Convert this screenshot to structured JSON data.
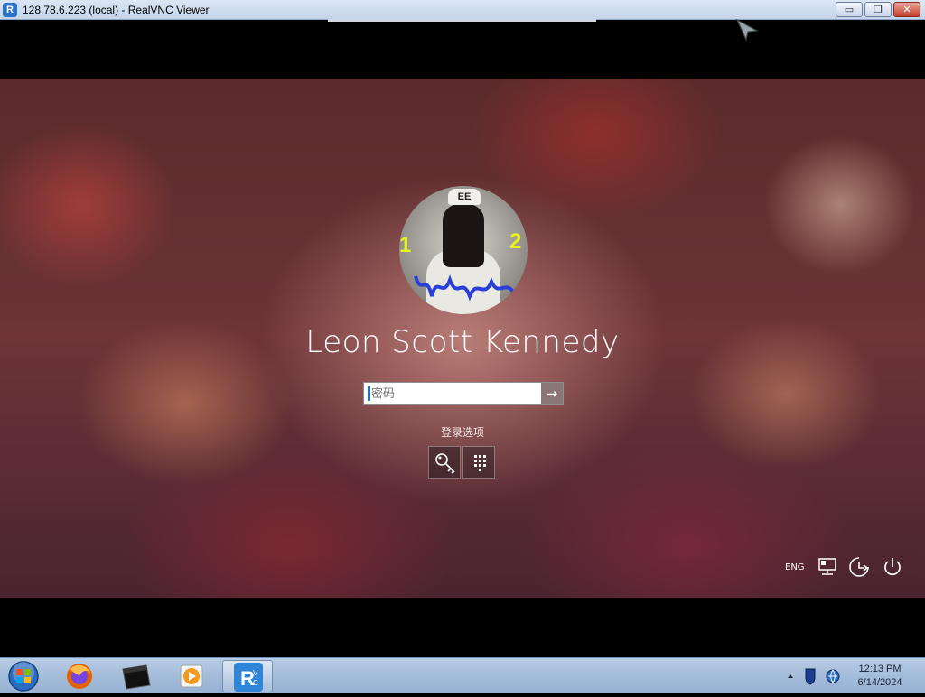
{
  "window": {
    "title": "128.78.6.223 (local) - RealVNC Viewer",
    "app_icon_letter": "R",
    "minimize_glyph": "▭",
    "maximize_glyph": "❐",
    "close_glyph": "✕"
  },
  "lockscreen": {
    "avatar": {
      "cap_text": "EE",
      "number_left": "1",
      "number_right": "2"
    },
    "username": "Leon Scott Kennedy",
    "password_placeholder": "密码",
    "submit_glyph": "→",
    "signin_options_label": "登录选项",
    "signin_options": [
      {
        "name": "password-key",
        "icon": "key-icon"
      },
      {
        "name": "pin-keypad",
        "icon": "keypad-icon"
      }
    ],
    "language": "ENG",
    "system_icons": [
      "network-icon",
      "accessibility-icon",
      "power-icon"
    ]
  },
  "taskbar": {
    "items": [
      {
        "name": "start-orb",
        "icon": "windows-orb-icon"
      },
      {
        "name": "firefox",
        "icon": "firefox-icon"
      },
      {
        "name": "terminal",
        "icon": "terminal-icon"
      },
      {
        "name": "media-player",
        "icon": "media-player-icon"
      },
      {
        "name": "realvnc-viewer",
        "icon": "realvnc-icon",
        "active": true
      }
    ],
    "clock": {
      "time": "12:13 PM",
      "date": "6/14/2024"
    }
  },
  "colors": {
    "accent_blue": "#1e6fd0",
    "taskbar": "#a4bcda",
    "close_button": "#c4402b"
  }
}
